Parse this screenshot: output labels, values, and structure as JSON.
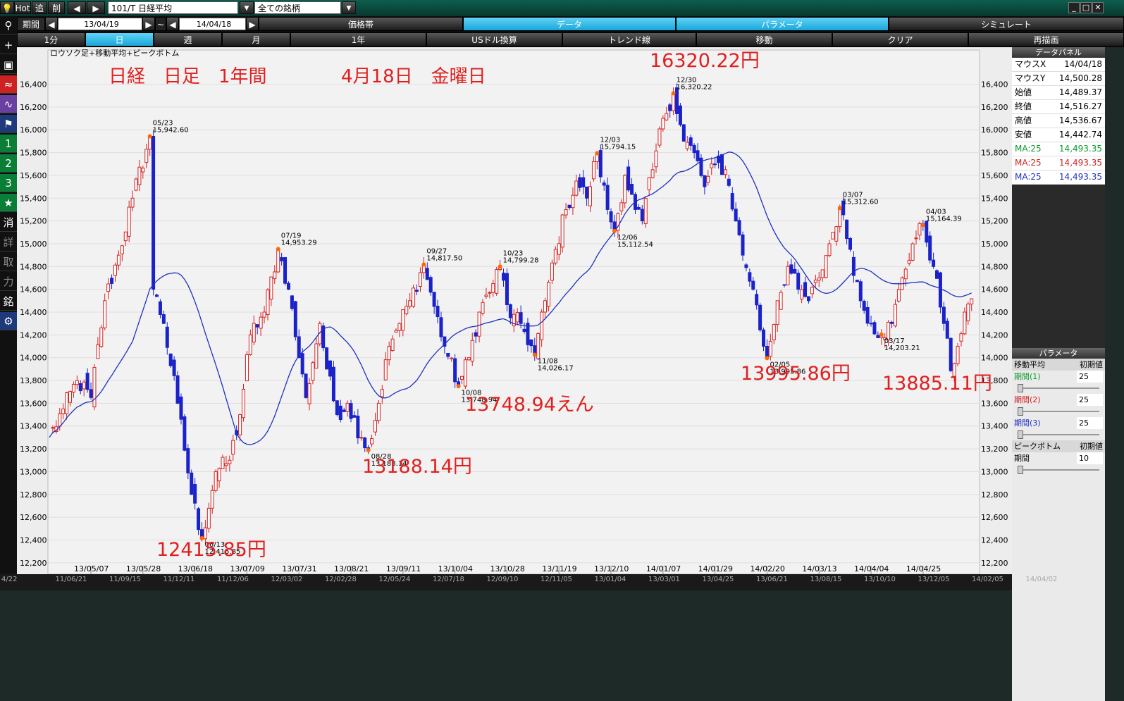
{
  "toolbar": {
    "hot": "Hot",
    "tsui": "追",
    "sakujo": "削",
    "symbol": "101/T 日経平均",
    "filter": "全ての銘柄"
  },
  "period": {
    "label": "期間",
    "from": "13/04/19",
    "sep": "~",
    "to": "14/04/18"
  },
  "tabs_row2": [
    "価格帯",
    "データ",
    "パラメータ",
    "シミュレート"
  ],
  "tabs_row3": [
    "1分",
    "日",
    "週",
    "月",
    "1年",
    "USドル換算",
    "トレンド線",
    "移動",
    "クリア",
    "再描画"
  ],
  "sidebar": [
    "消",
    "詳",
    "取",
    "力",
    "銘"
  ],
  "sidebar_num": [
    "1",
    "2",
    "3"
  ],
  "chart_header": "ロウソク足+移動平均+ピークボトム",
  "annotations": {
    "main_title": "日経　日足　1年間",
    "date": "4月18日　金曜日",
    "high_label": "16320.22円",
    "low1": "12415.85円",
    "low2": "13188.14円",
    "low3": "13748.94えん",
    "low4": "13995.86円",
    "low5": "13885.11円"
  },
  "data_panel": {
    "title": "データパネル",
    "rows": [
      {
        "k": "マウスX",
        "v": "14/04/18",
        "color": "#000000"
      },
      {
        "k": "マウスY",
        "v": "14,500.28",
        "color": "#000000"
      },
      {
        "k": "始値",
        "v": "14,489.37",
        "color": "#000000"
      },
      {
        "k": "終値",
        "v": "14,516.27",
        "color": "#000000"
      },
      {
        "k": "高値",
        "v": "14,536.67",
        "color": "#000000"
      },
      {
        "k": "安値",
        "v": "14,442.74",
        "color": "#000000"
      },
      {
        "k": "MA:25",
        "v": "14,493.35",
        "color": "#0a9a2a"
      },
      {
        "k": "MA:25",
        "v": "14,493.35",
        "color": "#d42020"
      },
      {
        "k": "MA:25",
        "v": "14,493.35",
        "color": "#2030c0"
      }
    ]
  },
  "param_panel": {
    "title": "パラメータ",
    "ma_header": [
      "移動平均",
      "初期値"
    ],
    "ma_rows": [
      {
        "k": "期間(1)",
        "v": "25",
        "color": "#0a9a2a"
      },
      {
        "k": "期間(2)",
        "v": "25",
        "color": "#d42020"
      },
      {
        "k": "期間(3)",
        "v": "25",
        "color": "#2030c0"
      }
    ],
    "pb_header": [
      "ピークボトム",
      "初期値"
    ],
    "pb_rows": [
      {
        "k": "期間",
        "v": "10",
        "color": "#000000"
      }
    ]
  },
  "bottom_dates": [
    "4/22",
    "11/06/21",
    "11/09/15",
    "11/12/11",
    "11/12/06",
    "12/03/02",
    "12/02/28",
    "12/05/24",
    "12/07/18",
    "12/09/10",
    "12/11/05",
    "13/01/04",
    "13/03/01",
    "13/04/25",
    "13/06/21",
    "13/08/15",
    "13/10/10",
    "13/12/05",
    "14/02/05",
    "14/04/02"
  ],
  "chart_data": {
    "type": "candlestick",
    "title": "ロウソク足+移動平均+ピークボトム",
    "ylim": [
      12100,
      16700
    ],
    "y_ticks": [
      12200,
      12400,
      12600,
      12800,
      13000,
      13200,
      13400,
      13600,
      13800,
      14000,
      14200,
      14400,
      14600,
      14800,
      15000,
      15200,
      15400,
      15600,
      15800,
      16000,
      16200,
      16400
    ],
    "y_tick_labels": [
      "12,200",
      "12,400",
      "12,600",
      "12,800",
      "13,000",
      "13,200",
      "13,400",
      "13,600",
      "13,800",
      "14,000",
      "14,200",
      "14,400",
      "14,600",
      "14,800",
      "15,000",
      "15,200",
      "15,400",
      "15,600",
      "15,800",
      "16,000",
      "16,200",
      "16,400"
    ],
    "x_tick_labels": [
      {
        "i": 12,
        "label": "13/05/07"
      },
      {
        "i": 27,
        "label": "13/05/28"
      },
      {
        "i": 42,
        "label": "13/06/18"
      },
      {
        "i": 57,
        "label": "13/07/09"
      },
      {
        "i": 72,
        "label": "13/07/31"
      },
      {
        "i": 87,
        "label": "13/08/21"
      },
      {
        "i": 102,
        "label": "13/09/11"
      },
      {
        "i": 117,
        "label": "13/10/04"
      },
      {
        "i": 132,
        "label": "13/10/28"
      },
      {
        "i": 147,
        "label": "13/11/19"
      },
      {
        "i": 162,
        "label": "13/12/10"
      },
      {
        "i": 177,
        "label": "14/01/07"
      },
      {
        "i": 192,
        "label": "14/01/29"
      },
      {
        "i": 207,
        "label": "14/02/20"
      },
      {
        "i": 222,
        "label": "14/03/13"
      },
      {
        "i": 237,
        "label": "14/04/04"
      },
      {
        "i": 252,
        "label": "14/04/25"
      }
    ],
    "anchors": [
      [
        0,
        13300
      ],
      [
        4,
        13550
      ],
      [
        8,
        13800
      ],
      [
        12,
        13650
      ],
      [
        16,
        14500
      ],
      [
        20,
        14900
      ],
      [
        24,
        15400
      ],
      [
        29,
        15942.6
      ],
      [
        30,
        14600
      ],
      [
        33,
        14300
      ],
      [
        37,
        13600
      ],
      [
        41,
        12800
      ],
      [
        44,
        12415.85
      ],
      [
        48,
        13000
      ],
      [
        52,
        13100
      ],
      [
        55,
        13500
      ],
      [
        58,
        14200
      ],
      [
        62,
        14400
      ],
      [
        66,
        14953.29
      ],
      [
        69,
        14600
      ],
      [
        72,
        14000
      ],
      [
        74,
        13650
      ],
      [
        78,
        14300
      ],
      [
        80,
        13900
      ],
      [
        83,
        13500
      ],
      [
        86,
        13600
      ],
      [
        90,
        13300
      ],
      [
        92,
        13188.14
      ],
      [
        95,
        13600
      ],
      [
        98,
        14100
      ],
      [
        101,
        14300
      ],
      [
        104,
        14500
      ],
      [
        108,
        14817.5
      ],
      [
        111,
        14450
      ],
      [
        114,
        14100
      ],
      [
        118,
        13748.94
      ],
      [
        121,
        14000
      ],
      [
        124,
        14400
      ],
      [
        128,
        14650
      ],
      [
        130,
        14799.28
      ],
      [
        133,
        14350
      ],
      [
        136,
        14300
      ],
      [
        140,
        14026.17
      ],
      [
        143,
        14500
      ],
      [
        146,
        14950
      ],
      [
        149,
        15300
      ],
      [
        152,
        15550
      ],
      [
        155,
        15400
      ],
      [
        158,
        15794.15
      ],
      [
        161,
        15300
      ],
      [
        163,
        15112.54
      ],
      [
        166,
        15600
      ],
      [
        169,
        15300
      ],
      [
        171,
        15200
      ],
      [
        174,
        15650
      ],
      [
        177,
        16100
      ],
      [
        180,
        16320.22
      ],
      [
        183,
        15900
      ],
      [
        186,
        15800
      ],
      [
        189,
        15500
      ],
      [
        192,
        15700
      ],
      [
        195,
        15650
      ],
      [
        198,
        15200
      ],
      [
        200,
        14900
      ],
      [
        203,
        14600
      ],
      [
        206,
        14100
      ],
      [
        207,
        13995.86
      ],
      [
        210,
        14500
      ],
      [
        213,
        14800
      ],
      [
        216,
        14600
      ],
      [
        219,
        14500
      ],
      [
        222,
        14700
      ],
      [
        225,
        15000
      ],
      [
        228,
        15312.6
      ],
      [
        231,
        14950
      ],
      [
        234,
        14500
      ],
      [
        237,
        14300
      ],
      [
        240,
        14203.21
      ],
      [
        243,
        14300
      ],
      [
        246,
        14700
      ],
      [
        249,
        15000
      ],
      [
        252,
        15164.39
      ],
      [
        255,
        14800
      ],
      [
        258,
        14300
      ],
      [
        260,
        13885.11
      ],
      [
        262,
        14100
      ],
      [
        264,
        14400
      ],
      [
        266,
        14516.27
      ]
    ],
    "series": [
      {
        "name": "MA:25",
        "color": "#2030c0",
        "type": "line"
      }
    ],
    "peak_labels": [
      {
        "i": 29,
        "date": "05/23",
        "value": "15,942.60",
        "price": 15942.6,
        "kind": "peak"
      },
      {
        "i": 44,
        "date": "06/13",
        "value": "12,415.85",
        "price": 12415.85,
        "kind": "bottom"
      },
      {
        "i": 66,
        "date": "07/19",
        "value": "14,953.29",
        "price": 14953.29,
        "kind": "peak"
      },
      {
        "i": 92,
        "date": "08/28",
        "value": "13,188.14",
        "price": 13188.14,
        "kind": "bottom"
      },
      {
        "i": 108,
        "date": "09/27",
        "value": "14,817.50",
        "price": 14817.5,
        "kind": "peak"
      },
      {
        "i": 118,
        "date": "10/08",
        "value": "13,748.94",
        "price": 13748.94,
        "kind": "bottom"
      },
      {
        "i": 130,
        "date": "10/23",
        "value": "14,799.28",
        "price": 14799.28,
        "kind": "peak"
      },
      {
        "i": 140,
        "date": "11/08",
        "value": "14,026.17",
        "price": 14026.17,
        "kind": "bottom"
      },
      {
        "i": 158,
        "date": "12/03",
        "value": "15,794.15",
        "price": 15794.15,
        "kind": "peak"
      },
      {
        "i": 163,
        "date": "12/06",
        "value": "15,112.54",
        "price": 15112.54,
        "kind": "bottom"
      },
      {
        "i": 180,
        "date": "12/30",
        "value": "16,320.22",
        "price": 16320.22,
        "kind": "peak"
      },
      {
        "i": 207,
        "date": "02/05",
        "value": "13,995.86",
        "price": 13995.86,
        "kind": "bottom"
      },
      {
        "i": 228,
        "date": "03/07",
        "value": "15,312.60",
        "price": 15312.6,
        "kind": "peak"
      },
      {
        "i": 240,
        "date": "03/17",
        "value": "14,203.21",
        "price": 14203.21,
        "kind": "bottom"
      },
      {
        "i": 252,
        "date": "04/03",
        "value": "15,164.39",
        "price": 15164.39,
        "kind": "peak"
      }
    ]
  }
}
